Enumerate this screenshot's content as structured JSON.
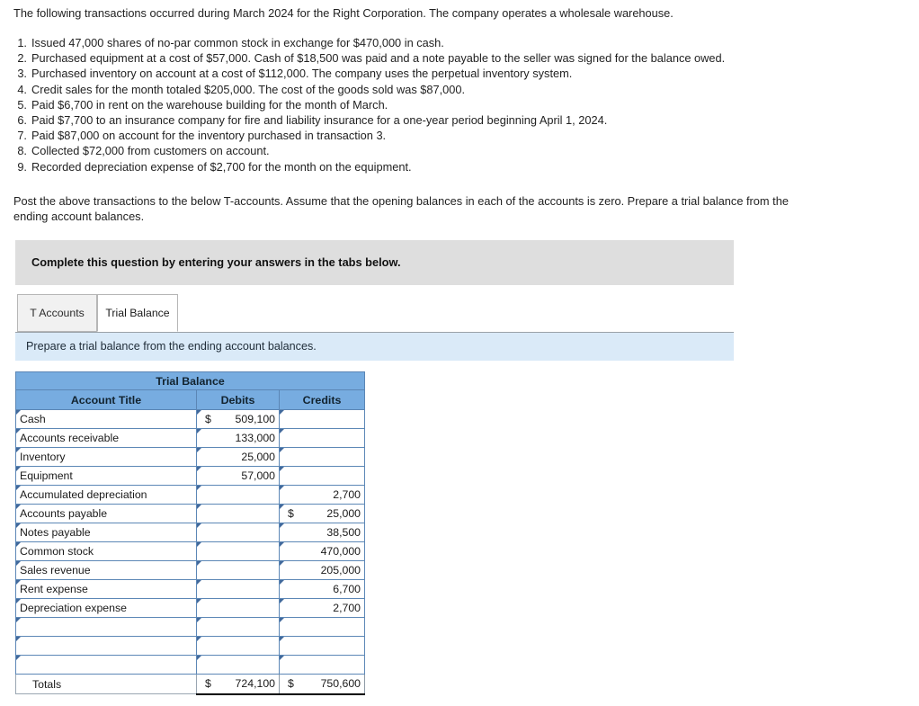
{
  "intro": "The following transactions occurred during March 2024 for the Right Corporation. The company operates a wholesale warehouse.",
  "transactions": [
    {
      "num": "1.",
      "text": "Issued 47,000 shares of no-par common stock in exchange for $470,000 in cash."
    },
    {
      "num": "2.",
      "text": "Purchased equipment at a cost of $57,000. Cash of $18,500 was paid and a note payable to the seller was signed for the balance owed."
    },
    {
      "num": "3.",
      "text": "Purchased inventory on account at a cost of $112,000. The company uses the perpetual inventory system."
    },
    {
      "num": "4.",
      "text": "Credit sales for the month totaled $205,000. The cost of the goods sold was $87,000."
    },
    {
      "num": "5.",
      "text": "Paid $6,700 in rent on the warehouse building for the month of March."
    },
    {
      "num": "6.",
      "text": "Paid $7,700 to an insurance company for fire and liability insurance for a one-year period beginning April 1, 2024."
    },
    {
      "num": "7.",
      "text": "Paid $87,000 on account for the inventory purchased in transaction 3."
    },
    {
      "num": "8.",
      "text": "Collected $72,000 from customers on account."
    },
    {
      "num": "9.",
      "text": "Recorded depreciation expense of $2,700 for the month on the equipment."
    }
  ],
  "post_note": "Post the above transactions to the below T-accounts. Assume that the opening balances in each of the accounts is zero. Prepare a trial balance from the ending account balances.",
  "banner": {
    "text": "Complete this question by entering your answers in the tabs below."
  },
  "tabs": [
    {
      "label": "T Accounts",
      "active": false
    },
    {
      "label": "Trial Balance",
      "active": true
    }
  ],
  "instruction": "Prepare a trial balance from the ending account balances.",
  "table": {
    "title": "Trial Balance",
    "columns": [
      "Account Title",
      "Debits",
      "Credits"
    ],
    "rows": [
      {
        "account": "Cash",
        "debit_cur": "$",
        "debit": "509,100",
        "credit_cur": "",
        "credit": ""
      },
      {
        "account": "Accounts receivable",
        "debit_cur": "",
        "debit": "133,000",
        "credit_cur": "",
        "credit": ""
      },
      {
        "account": "Inventory",
        "debit_cur": "",
        "debit": "25,000",
        "credit_cur": "",
        "credit": ""
      },
      {
        "account": "Equipment",
        "debit_cur": "",
        "debit": "57,000",
        "credit_cur": "",
        "credit": ""
      },
      {
        "account": "Accumulated depreciation",
        "debit_cur": "",
        "debit": "",
        "credit_cur": "",
        "credit": "2,700"
      },
      {
        "account": "Accounts payable",
        "debit_cur": "",
        "debit": "",
        "credit_cur": "$",
        "credit": "25,000"
      },
      {
        "account": "Notes payable",
        "debit_cur": "",
        "debit": "",
        "credit_cur": "",
        "credit": "38,500"
      },
      {
        "account": "Common stock",
        "debit_cur": "",
        "debit": "",
        "credit_cur": "",
        "credit": "470,000"
      },
      {
        "account": "Sales revenue",
        "debit_cur": "",
        "debit": "",
        "credit_cur": "",
        "credit": "205,000"
      },
      {
        "account": "Rent expense",
        "debit_cur": "",
        "debit": "",
        "credit_cur": "",
        "credit": "6,700"
      },
      {
        "account": "Depreciation expense",
        "debit_cur": "",
        "debit": "",
        "credit_cur": "",
        "credit": "2,700"
      },
      {
        "account": "",
        "debit_cur": "",
        "debit": "",
        "credit_cur": "",
        "credit": ""
      },
      {
        "account": "",
        "debit_cur": "",
        "debit": "",
        "credit_cur": "",
        "credit": ""
      },
      {
        "account": "",
        "debit_cur": "",
        "debit": "",
        "credit_cur": "",
        "credit": ""
      }
    ],
    "totals": {
      "label": "Totals",
      "debit_cur": "$",
      "debit": "724,100",
      "credit_cur": "$",
      "credit": "750,600"
    }
  },
  "colors": {
    "header_blue": "#77ace0",
    "instruction_blue": "#daeaf8",
    "banner_gray": "#dedede",
    "cell_border": "#5c87b6"
  }
}
